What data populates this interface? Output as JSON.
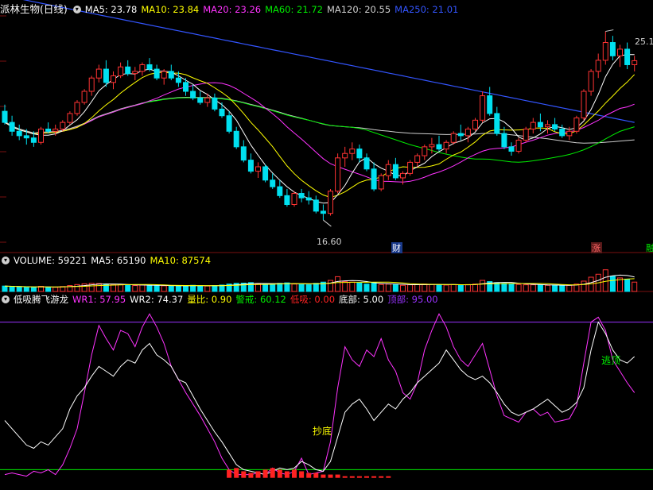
{
  "header": {
    "title": "派林生物(日线)",
    "ma": [
      {
        "label": "MA5: 23.78",
        "color": "#ffffff"
      },
      {
        "label": "MA10: 23.84",
        "color": "#ffff00"
      },
      {
        "label": "MA20: 23.26",
        "color": "#ff33ff"
      },
      {
        "label": "MA60: 21.72",
        "color": "#00ee00"
      },
      {
        "label": "MA120: 20.55",
        "color": "#cfcfcf"
      },
      {
        "label": "MA250: 21.01",
        "color": "#3355ff"
      }
    ]
  },
  "volume_header": [
    {
      "label": "VOLUME: 59221",
      "color": "#ffffff"
    },
    {
      "label": "MA5: 65190",
      "color": "#ffffff"
    },
    {
      "label": "MA10: 87574",
      "color": "#ffff00"
    }
  ],
  "indicator_header": {
    "name": "低吸腾飞游龙",
    "items": [
      {
        "label": "WR1: 57.95",
        "color": "#ff33ff"
      },
      {
        "label": "WR2: 74.37",
        "color": "#ffffff"
      },
      {
        "label": "量比: 0.90",
        "color": "#ffff00"
      },
      {
        "label": "警戒: 60.12",
        "color": "#00ee00"
      },
      {
        "label": "低吸: 0.00",
        "color": "#ff2222"
      },
      {
        "label": "底部: 5.00",
        "color": "#ffffff"
      },
      {
        "label": "顶部: 95.00",
        "color": "#9933ff"
      }
    ]
  },
  "annotations": {
    "high_label": "25.1",
    "low_label": "16.60",
    "cai_badge": "财",
    "zhang_badge": "涨",
    "edge_badge": "融",
    "buy_signal": "抄底",
    "sell_signal": "逃顶"
  },
  "chart_data": [
    {
      "type": "candlestick",
      "title": "派林生物(日线)",
      "note": "Approximate daily OHLC read from the chart, oldest to newest",
      "ohlc": [
        [
          21.5,
          21.8,
          20.9,
          21.0
        ],
        [
          21.0,
          21.3,
          20.4,
          20.6
        ],
        [
          20.6,
          20.9,
          20.2,
          20.4
        ],
        [
          20.4,
          20.7,
          20.0,
          20.3
        ],
        [
          20.3,
          20.6,
          19.9,
          20.1
        ],
        [
          20.1,
          20.8,
          20.0,
          20.7
        ],
        [
          20.7,
          21.0,
          20.5,
          20.6
        ],
        [
          20.6,
          20.9,
          20.4,
          20.7
        ],
        [
          20.7,
          21.1,
          20.6,
          21.0
        ],
        [
          21.0,
          21.5,
          20.9,
          21.4
        ],
        [
          21.4,
          22.0,
          21.3,
          21.9
        ],
        [
          21.9,
          22.5,
          21.8,
          22.4
        ],
        [
          22.4,
          23.1,
          22.2,
          23.0
        ],
        [
          23.0,
          23.6,
          22.8,
          23.4
        ],
        [
          23.4,
          23.8,
          22.6,
          22.8
        ],
        [
          22.8,
          23.3,
          22.5,
          23.1
        ],
        [
          23.1,
          23.7,
          23.0,
          23.5
        ],
        [
          23.5,
          23.8,
          23.1,
          23.2
        ],
        [
          23.2,
          23.5,
          22.9,
          23.3
        ],
        [
          23.3,
          23.7,
          23.1,
          23.6
        ],
        [
          23.6,
          23.9,
          23.3,
          23.4
        ],
        [
          23.4,
          23.6,
          22.9,
          23.0
        ],
        [
          23.0,
          23.4,
          22.7,
          23.3
        ],
        [
          23.3,
          23.6,
          22.9,
          23.0
        ],
        [
          23.0,
          23.3,
          22.6,
          22.8
        ],
        [
          22.8,
          23.0,
          22.2,
          22.4
        ],
        [
          22.4,
          22.7,
          22.0,
          22.1
        ],
        [
          22.1,
          22.4,
          21.8,
          21.9
        ],
        [
          21.9,
          22.3,
          21.7,
          22.1
        ],
        [
          22.1,
          22.3,
          21.5,
          21.6
        ],
        [
          21.6,
          21.9,
          21.2,
          21.3
        ],
        [
          21.3,
          21.5,
          20.5,
          20.6
        ],
        [
          20.6,
          20.8,
          19.8,
          19.9
        ],
        [
          19.9,
          20.2,
          19.2,
          19.3
        ],
        [
          19.3,
          19.6,
          18.7,
          18.8
        ],
        [
          18.8,
          19.2,
          18.5,
          19.0
        ],
        [
          19.0,
          19.1,
          18.3,
          18.4
        ],
        [
          18.4,
          18.7,
          18.0,
          18.1
        ],
        [
          18.1,
          18.4,
          17.6,
          17.7
        ],
        [
          17.7,
          18.0,
          17.2,
          17.3
        ],
        [
          17.3,
          17.9,
          17.2,
          17.8
        ],
        [
          17.8,
          18.0,
          17.4,
          17.6
        ],
        [
          17.6,
          17.9,
          17.3,
          17.5
        ],
        [
          17.5,
          17.7,
          16.9,
          17.0
        ],
        [
          17.0,
          17.3,
          16.6,
          16.9
        ],
        [
          16.9,
          18.0,
          16.8,
          17.9
        ],
        [
          17.9,
          19.6,
          17.8,
          19.4
        ],
        [
          19.4,
          19.9,
          19.0,
          19.6
        ],
        [
          19.6,
          20.1,
          19.3,
          19.8
        ],
        [
          19.8,
          20.0,
          19.2,
          19.4
        ],
        [
          19.4,
          19.6,
          18.8,
          18.9
        ],
        [
          18.9,
          19.2,
          17.9,
          18.0
        ],
        [
          18.0,
          18.7,
          17.9,
          18.6
        ],
        [
          18.6,
          19.3,
          18.4,
          19.1
        ],
        [
          19.1,
          19.4,
          18.4,
          18.5
        ],
        [
          18.5,
          18.8,
          18.2,
          18.7
        ],
        [
          18.7,
          19.3,
          18.6,
          19.2
        ],
        [
          19.2,
          19.6,
          19.0,
          19.5
        ],
        [
          19.5,
          20.0,
          19.3,
          19.9
        ],
        [
          19.9,
          20.3,
          19.6,
          20.0
        ],
        [
          20.0,
          20.4,
          19.7,
          19.8
        ],
        [
          19.8,
          20.2,
          19.6,
          20.1
        ],
        [
          20.1,
          20.6,
          20.0,
          20.5
        ],
        [
          20.5,
          20.9,
          20.2,
          20.4
        ],
        [
          20.4,
          20.8,
          20.1,
          20.7
        ],
        [
          20.7,
          21.2,
          20.6,
          21.1
        ],
        [
          21.1,
          22.4,
          21.0,
          22.2
        ],
        [
          22.2,
          22.6,
          21.3,
          21.4
        ],
        [
          21.4,
          21.7,
          20.4,
          20.5
        ],
        [
          20.5,
          20.8,
          19.8,
          19.9
        ],
        [
          19.9,
          20.1,
          19.5,
          19.7
        ],
        [
          19.7,
          20.3,
          19.6,
          20.2
        ],
        [
          20.2,
          20.8,
          20.1,
          20.7
        ],
        [
          20.7,
          21.2,
          20.5,
          21.0
        ],
        [
          21.0,
          21.4,
          20.6,
          20.8
        ],
        [
          20.8,
          21.1,
          20.5,
          20.9
        ],
        [
          20.9,
          21.2,
          20.6,
          20.7
        ],
        [
          20.7,
          20.9,
          20.3,
          20.4
        ],
        [
          20.4,
          20.8,
          20.2,
          20.6
        ],
        [
          20.6,
          21.3,
          20.5,
          21.2
        ],
        [
          21.2,
          22.5,
          21.1,
          22.4
        ],
        [
          22.4,
          23.4,
          22.2,
          23.3
        ],
        [
          23.3,
          24.1,
          23.0,
          23.8
        ],
        [
          23.8,
          25.1,
          23.6,
          24.6
        ],
        [
          24.6,
          24.9,
          23.8,
          24.0
        ],
        [
          24.0,
          24.5,
          23.5,
          24.3
        ],
        [
          24.3,
          24.6,
          23.4,
          23.6
        ],
        [
          23.6,
          24.0,
          23.3,
          23.78
        ]
      ],
      "ylim": [
        15.6,
        25.8
      ],
      "high": 25.1,
      "low": 16.6
    },
    {
      "type": "bar",
      "title": "VOLUME",
      "note": "Relative daily volume (scaled 0-100), colors follow candle direction",
      "values": [
        22,
        20,
        18,
        17,
        16,
        21,
        18,
        17,
        20,
        24,
        28,
        31,
        33,
        32,
        29,
        27,
        28,
        25,
        24,
        26,
        25,
        24,
        23,
        22,
        22,
        24,
        25,
        23,
        22,
        24,
        26,
        30,
        33,
        34,
        36,
        30,
        29,
        31,
        33,
        35,
        30,
        28,
        27,
        33,
        38,
        45,
        60,
        40,
        38,
        34,
        30,
        36,
        28,
        30,
        27,
        25,
        27,
        28,
        30,
        29,
        27,
        26,
        28,
        27,
        28,
        30,
        45,
        40,
        36,
        33,
        30,
        28,
        27,
        27,
        26,
        25,
        26,
        24,
        25,
        30,
        42,
        58,
        70,
        88,
        62,
        55,
        50,
        38
      ],
      "ylim": [
        0,
        100
      ]
    },
    {
      "type": "line",
      "title": "低吸腾飞游龙",
      "ylim": [
        -5,
        105
      ],
      "series": [
        {
          "name": "WR1",
          "color": "#ff33ff",
          "values": [
            2,
            3,
            2,
            1,
            4,
            3,
            5,
            2,
            8,
            18,
            30,
            52,
            75,
            93,
            85,
            78,
            90,
            88,
            80,
            92,
            100,
            92,
            82,
            68,
            60,
            52,
            45,
            38,
            30,
            22,
            12,
            5,
            2,
            2,
            2,
            3,
            2,
            6,
            3,
            2,
            4,
            12,
            2,
            3,
            4,
            22,
            55,
            80,
            72,
            68,
            78,
            74,
            85,
            72,
            65,
            52,
            48,
            58,
            78,
            90,
            100,
            92,
            80,
            72,
            68,
            75,
            82,
            66,
            50,
            38,
            36,
            34,
            40,
            42,
            38,
            40,
            34,
            35,
            36,
            44,
            70,
            95,
            98,
            90,
            72,
            65,
            58,
            52
          ],
          "style": "line"
        },
        {
          "name": "WR2",
          "color": "#ffffff",
          "values": [
            35,
            30,
            25,
            20,
            18,
            22,
            20,
            25,
            30,
            42,
            50,
            55,
            62,
            68,
            65,
            62,
            68,
            72,
            70,
            78,
            82,
            75,
            72,
            68,
            60,
            58,
            50,
            42,
            35,
            28,
            22,
            15,
            8,
            5,
            4,
            3,
            2,
            4,
            6,
            5,
            6,
            10,
            8,
            5,
            4,
            10,
            25,
            40,
            45,
            48,
            42,
            35,
            40,
            45,
            42,
            48,
            52,
            58,
            62,
            66,
            70,
            78,
            72,
            66,
            62,
            60,
            62,
            58,
            52,
            45,
            40,
            38,
            40,
            42,
            45,
            48,
            44,
            40,
            42,
            46,
            55,
            78,
            95,
            88,
            78,
            72,
            70,
            74
          ],
          "style": "line"
        },
        {
          "name": "低吸",
          "color": "#ff2222",
          "values": [
            0,
            0,
            0,
            0,
            0,
            0,
            0,
            0,
            0,
            0,
            0,
            0,
            0,
            0,
            0,
            0,
            0,
            0,
            0,
            0,
            0,
            0,
            0,
            0,
            0,
            0,
            0,
            0,
            0,
            0,
            0,
            5,
            6,
            4,
            3,
            4,
            5,
            6,
            5,
            4,
            5,
            4,
            3,
            3,
            2,
            2,
            2,
            1,
            1,
            1,
            1,
            1,
            1,
            1,
            0,
            0,
            0,
            0,
            0,
            0,
            0,
            0,
            0,
            0,
            0,
            0,
            0,
            0,
            0,
            0,
            0,
            0,
            0,
            0,
            0,
            0,
            0,
            0,
            0,
            0,
            0,
            0,
            0,
            0,
            0,
            0,
            0,
            0
          ],
          "style": "bar"
        }
      ],
      "hlines": [
        {
          "name": "底部",
          "value": 5,
          "color": "#00ee00"
        },
        {
          "name": "顶部",
          "value": 95,
          "color": "#9933ff"
        }
      ]
    }
  ]
}
